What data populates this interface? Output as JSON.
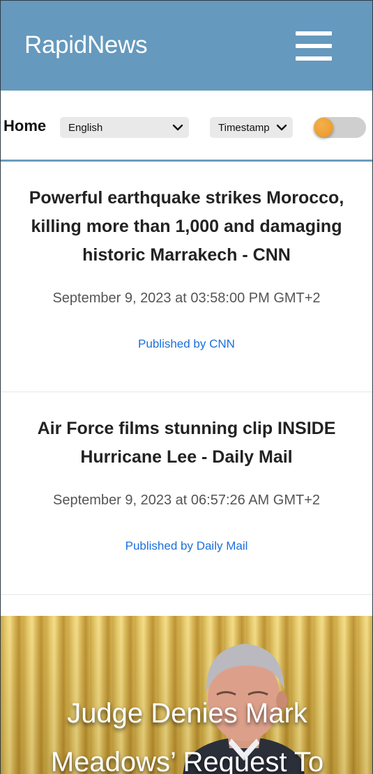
{
  "header": {
    "logo": "RapidNews"
  },
  "toolbar": {
    "home_label": "Home",
    "language": {
      "selected": "English"
    },
    "sort": {
      "selected": "Timestamp"
    },
    "toggle": {
      "on": false,
      "knob_color": "#e8952a"
    }
  },
  "articles": [
    {
      "title": "Powerful earthquake strikes Morocco, killing more than 1,000 and damaging historic Marrakech - CNN",
      "timestamp": "September 9, 2023 at 03:58:00 PM GMT+2",
      "source": "Published by CNN"
    },
    {
      "title": "Air Force films stunning clip INSIDE Hurricane Lee - Daily Mail",
      "timestamp": "September 9, 2023 at 06:57:26 AM GMT+2",
      "source": "Published by Daily Mail"
    }
  ],
  "feature": {
    "title": "Judge Denies Mark Meadows’ Request To"
  },
  "colors": {
    "header_bg": "#6599bd",
    "link": "#1a6fdd",
    "divider": "#6b9dbd"
  }
}
